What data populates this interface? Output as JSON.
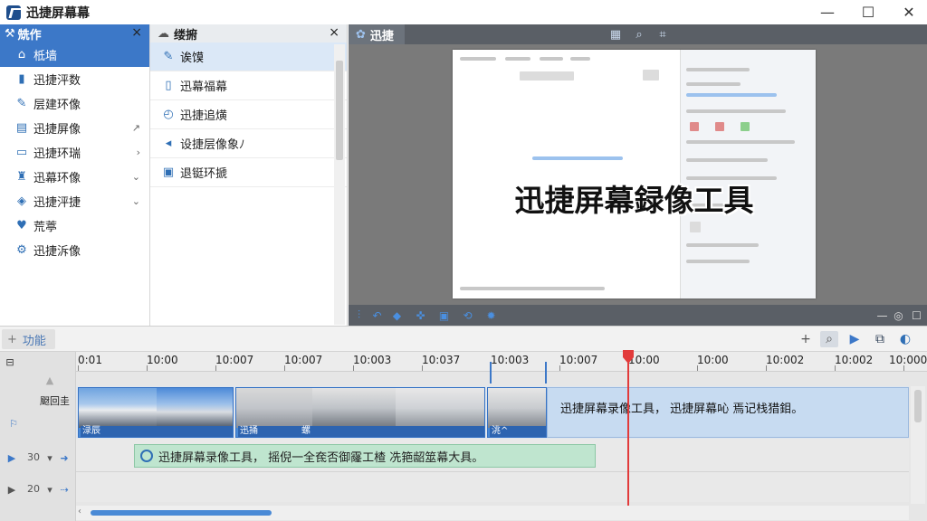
{
  "app": {
    "title": "迅捷屏幕幕"
  },
  "tools_panel": {
    "title": "兟作",
    "items": [
      {
        "label": "柢墙",
        "icon": "home-icon",
        "selected": true
      },
      {
        "label": "迅捷泙数",
        "icon": "film-icon"
      },
      {
        "label": "层建环像",
        "icon": "brush-icon"
      },
      {
        "label": "迅捷屏像",
        "icon": "image-icon",
        "arrow": "↗"
      },
      {
        "label": "迅捷环瑞",
        "icon": "window-icon",
        "arrow": "›"
      },
      {
        "label": "迅幕环像",
        "icon": "stamp-icon",
        "arrow": "⌄"
      },
      {
        "label": "迅捷泙捷",
        "icon": "shield-icon",
        "arrow": "⌄"
      },
      {
        "label": "荒葶",
        "icon": "heart-icon"
      },
      {
        "label": "迅捷泝像",
        "icon": "gear-icon"
      }
    ]
  },
  "effects_panel": {
    "title": "缕捬",
    "items": [
      {
        "label": "诶馍",
        "icon": "brush-icon",
        "selected": true
      },
      {
        "label": "迅幕福幕",
        "icon": "document-icon"
      },
      {
        "label": "迅捷追熿",
        "icon": "timer-icon"
      },
      {
        "label": "设捷层像象ﾉ",
        "icon": "arrow-left-icon"
      },
      {
        "label": "退铤环搋",
        "icon": "lock-icon"
      }
    ]
  },
  "preview": {
    "tab_label": "迅捷",
    "overlay_text": "迅捷屏幕録像工具"
  },
  "timeline": {
    "func_tab": "功能",
    "ruler_labels": [
      "0:01",
      "10:00",
      "10:007",
      "10:007",
      "10:003",
      "10:037",
      "10:003",
      "10:007",
      "10:00",
      "10:00",
      "10:002",
      "10:002",
      "10:000"
    ],
    "track_header_label": "颬回圭",
    "clips": [
      {
        "label": "渌辰"
      },
      {
        "label": "迅捅"
      },
      {
        "label": "螺"
      },
      {
        "label": "洮^"
      }
    ],
    "text_clip": "迅捷屏幕录像工具，  迅捷屏幕吣 焉记栈猎鉬。",
    "subtitle_clip": "迅捷屏幕录像工具，  摇倪一全奃否御霳工楂  冼筢龆筮幕大具。",
    "track_controls": {
      "sub_num": "30",
      "audio_num": "20"
    }
  },
  "colors": {
    "accent": "#3c78c8",
    "playhead": "#e23b3b",
    "subtitle": "#bfe5cf"
  }
}
